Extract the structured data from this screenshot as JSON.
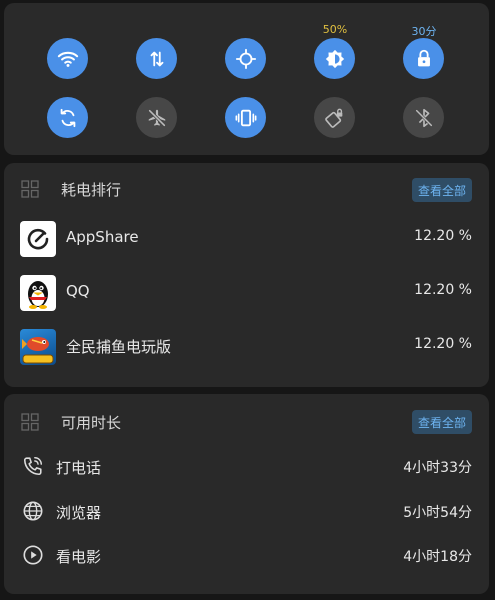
{
  "quick_toggles": {
    "row1": [
      {
        "name": "wifi",
        "icon": "wifi-icon",
        "state": "on"
      },
      {
        "name": "mobile-data",
        "icon": "data-arrows-icon",
        "state": "on"
      },
      {
        "name": "location",
        "icon": "location-icon",
        "state": "on"
      },
      {
        "name": "brightness",
        "icon": "brightness-icon",
        "state": "on",
        "label": "50%"
      },
      {
        "name": "screen-lock",
        "icon": "lock-icon",
        "state": "on",
        "label": "30分"
      }
    ],
    "row2": [
      {
        "name": "sync",
        "icon": "sync-icon",
        "state": "on"
      },
      {
        "name": "airplane",
        "icon": "airplane-off-icon",
        "state": "off"
      },
      {
        "name": "vibrate",
        "icon": "vibrate-icon",
        "state": "on"
      },
      {
        "name": "auto-rotate",
        "icon": "rotate-lock-icon",
        "state": "off"
      },
      {
        "name": "bluetooth",
        "icon": "bluetooth-off-icon",
        "state": "off"
      }
    ],
    "brightness_label_color": "#e0c040",
    "lock_label_color": "#6db3f0"
  },
  "battery_ranking": {
    "title": "耗电排行",
    "see_all": "查看全部",
    "apps": [
      {
        "name": "AppShare",
        "percent": "12.20 %",
        "icon": "appshare-icon"
      },
      {
        "name": "QQ",
        "percent": "12.20 %",
        "icon": "qq-penguin-icon"
      },
      {
        "name": "全民捕鱼电玩版",
        "percent": "12.20 %",
        "icon": "fishing-game-icon"
      }
    ]
  },
  "usage_time": {
    "title": "可用时长",
    "see_all": "查看全部",
    "items": [
      {
        "name": "打电话",
        "time": "4小时33分",
        "icon": "phone-icon"
      },
      {
        "name": "浏览器",
        "time": "5小时54分",
        "icon": "globe-icon"
      },
      {
        "name": "看电影",
        "time": "4小时18分",
        "icon": "play-icon"
      }
    ]
  },
  "colors": {
    "accent": "#4a90e8",
    "off": "#474747",
    "card": "#292929"
  }
}
